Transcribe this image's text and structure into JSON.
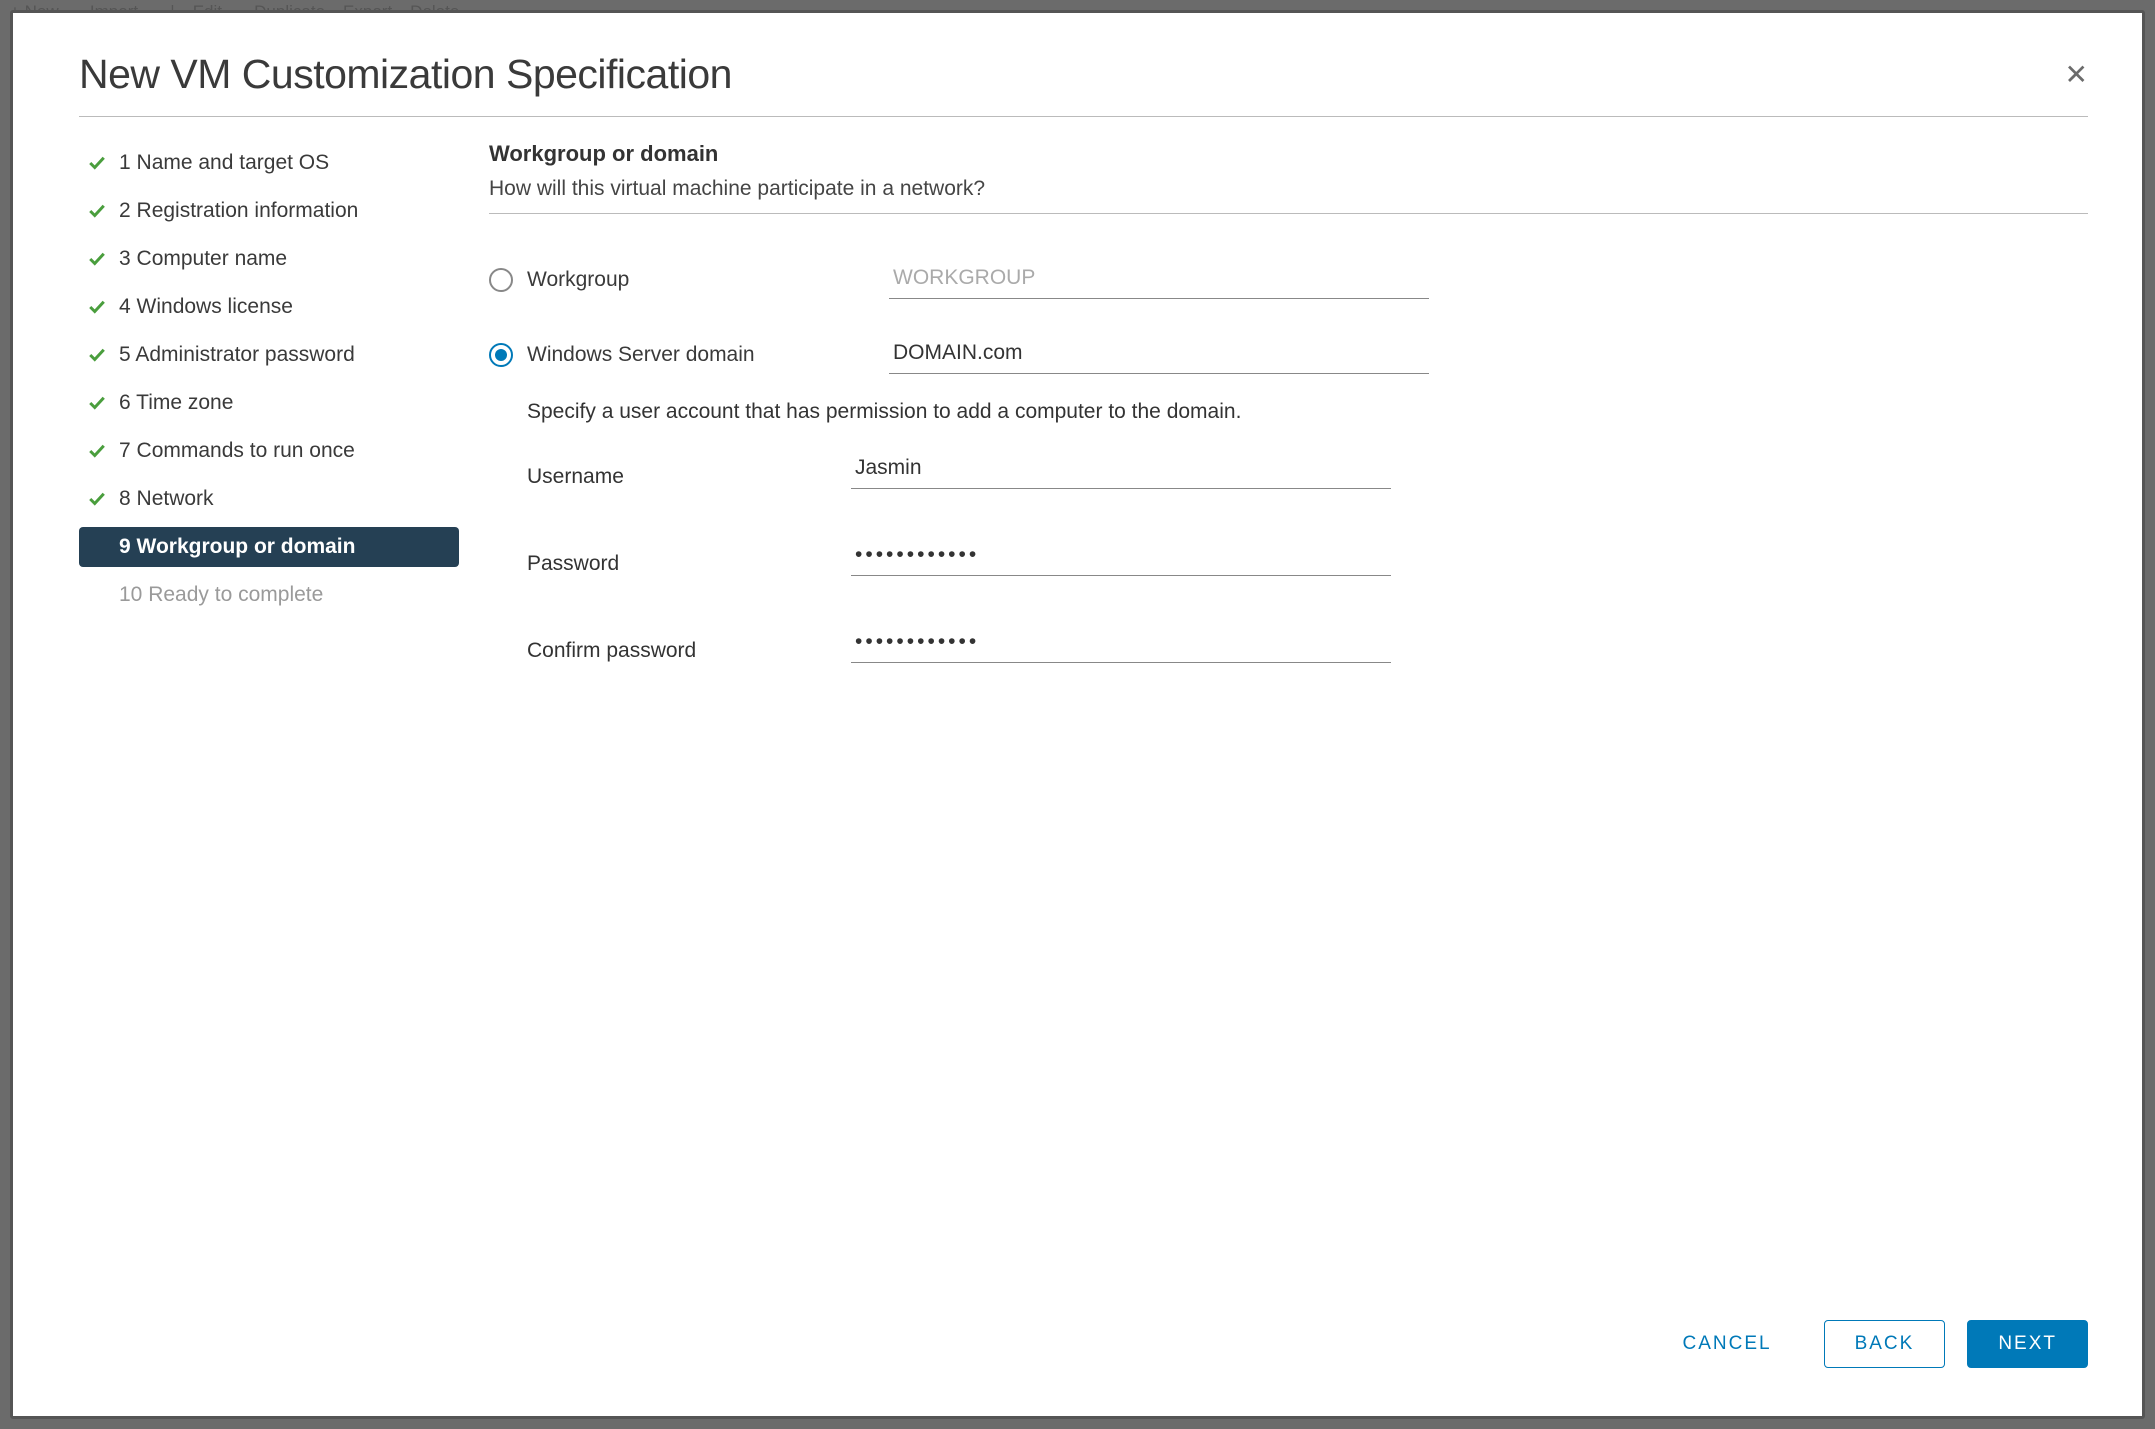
{
  "backdrop_toolbar": {
    "new": "New...",
    "import": "Import...",
    "edit": "Edit...",
    "duplicate": "Duplicate",
    "export": "Export",
    "delete": "Delete"
  },
  "dialog": {
    "title": "New VM Customization Specification"
  },
  "steps": [
    {
      "num": "1",
      "label": "Name and target OS",
      "state": "done"
    },
    {
      "num": "2",
      "label": "Registration information",
      "state": "done"
    },
    {
      "num": "3",
      "label": "Computer name",
      "state": "done"
    },
    {
      "num": "4",
      "label": "Windows license",
      "state": "done"
    },
    {
      "num": "5",
      "label": "Administrator password",
      "state": "done"
    },
    {
      "num": "6",
      "label": "Time zone",
      "state": "done"
    },
    {
      "num": "7",
      "label": "Commands to run once",
      "state": "done"
    },
    {
      "num": "8",
      "label": "Network",
      "state": "done"
    },
    {
      "num": "9",
      "label": "Workgroup or domain",
      "state": "active"
    },
    {
      "num": "10",
      "label": "Ready to complete",
      "state": "pending"
    }
  ],
  "content": {
    "title": "Workgroup or domain",
    "subtitle": "How will this virtual machine participate in a network?",
    "workgroup_label": "Workgroup",
    "workgroup_placeholder": "WORKGROUP",
    "domain_label": "Windows Server domain",
    "domain_value": "DOMAIN.com",
    "helper": "Specify a user account that has permission to add a computer to the domain.",
    "username_label": "Username",
    "username_value": "Jasmin",
    "password_label": "Password",
    "password_mask": "••••••••••••",
    "confirm_label": "Confirm password",
    "confirm_mask": "••••••••••••"
  },
  "footer": {
    "cancel": "CANCEL",
    "back": "BACK",
    "next": "NEXT"
  }
}
